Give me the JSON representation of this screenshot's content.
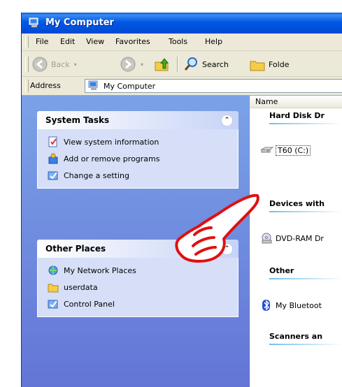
{
  "window": {
    "title": "My Computer",
    "title_icon": "my-computer-icon"
  },
  "menu": [
    "File",
    "Edit",
    "View",
    "Favorites",
    "Tools",
    "Help"
  ],
  "toolbar": {
    "back_label": "Back",
    "search_label": "Search",
    "folders_label": "Folde"
  },
  "address": {
    "label": "Address",
    "value": "My Computer"
  },
  "column_header": "Name",
  "system_tasks": {
    "title": "System Tasks",
    "items": [
      {
        "label": "View system information",
        "icon": "system-info-icon"
      },
      {
        "label": "Add or remove programs",
        "icon": "add-remove-programs-icon"
      },
      {
        "label": "Change a setting",
        "icon": "control-panel-icon"
      }
    ]
  },
  "other_places": {
    "title": "Other Places",
    "items": [
      {
        "label": "My Network Places",
        "icon": "network-places-icon"
      },
      {
        "label": "userdata",
        "icon": "folder-icon"
      },
      {
        "label": "Control Panel",
        "icon": "control-panel-icon"
      }
    ]
  },
  "groups": {
    "hard_disks": "Hard Disk Dr",
    "devices": "Devices with",
    "other": "Other",
    "scanners": "Scanners an"
  },
  "items": {
    "drive": "T60 (C:)",
    "dvd": "DVD-RAM Dr",
    "bluetooth": "My Bluetoot"
  },
  "colors": {
    "titlebar": "#0058e6",
    "taskpane_bg": "#6375d6",
    "panel_body": "#d6dff7",
    "pointer_hand": "#e01010"
  }
}
